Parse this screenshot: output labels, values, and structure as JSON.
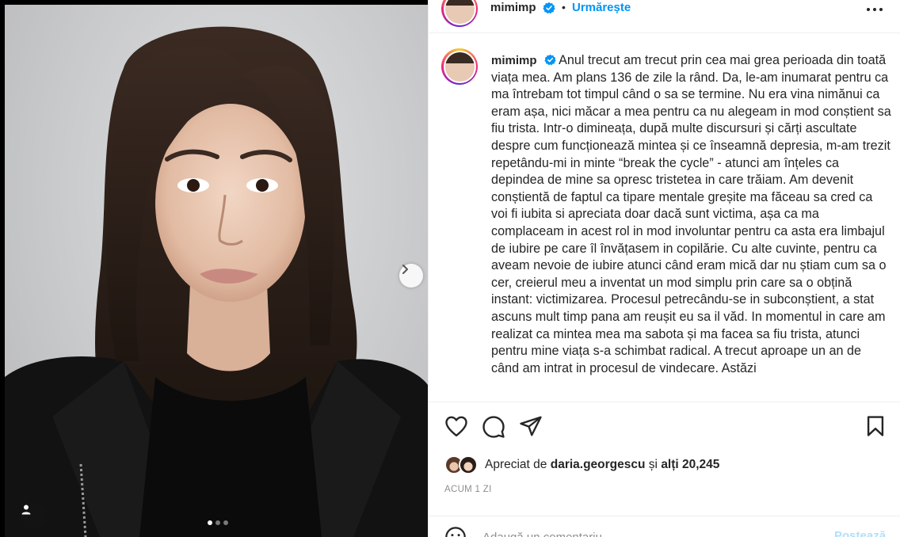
{
  "post": {
    "username": "mimimp",
    "follow_label": "Urmărește",
    "bullet": "•",
    "caption": "Anul trecut am trecut prin cea mai grea perioada din toată viața mea. Am plans 136 de zile la rând. Da, le-am inumarat pentru ca ma întrebam tot timpul când o sa se termine. Nu era vina nimănui ca eram așa, nici măcar a mea pentru ca nu alegeam in mod conștient sa fiu trista. Intr-o dimineața, după multe discursuri și cărți ascultate despre cum funcționează mintea și ce înseamnă depresia, m-am trezit repetându-mi in minte “break the cycle” - atunci am înțeles ca depindea de mine sa opresc tristetea in care trăiam. Am devenit conștientă de faptul ca tipare mentale greșite ma făceau sa cred ca voi fi iubita si apreciata doar dacă sunt victima, așa ca ma complaceam in acest rol in mod involuntar pentru ca asta era limbajul de iubire pe care îl învățasem in copilărie. Cu alte cuvinte, pentru ca aveam nevoie de iubire atunci când eram mică dar nu știam cum sa o cer, creierul meu a inventat un mod simplu prin care sa o obțină instant: victimizarea. Procesul petrecându-se in subconștient, a stat ascuns mult timp pana am reușit eu sa il văd. In momentul in care am realizat ca mintea mea ma sabota și ma facea sa fiu trista, atunci pentru mine viața s-a schimbat radical. A trecut aproape un an de când am intrat in procesul de vindecare. Astăzi",
    "likes": {
      "prefix": "Apreciat de",
      "user": "daria.georgescu",
      "middle": "și",
      "others": "alți 20,245"
    },
    "timestamp": "ACUM 1 ZI",
    "comment": {
      "placeholder": "Adaugă un comentariu...",
      "value": "",
      "post_label": "Postează"
    },
    "carousel": {
      "total": 3,
      "active_index": 0
    }
  },
  "icons": {
    "verified": "verified-badge-icon",
    "more": "more-options-icon",
    "like": "heart-icon",
    "comment": "comment-bubble-icon",
    "share": "paper-plane-icon",
    "save": "bookmark-icon",
    "next": "chevron-right-icon",
    "tag": "user-tag-icon",
    "emoji": "emoji-icon"
  },
  "colors": {
    "accent": "#0095f6",
    "post_disabled": "#b2dffc",
    "text": "#262626",
    "muted": "#8e8e8e",
    "divider": "#efefef"
  }
}
